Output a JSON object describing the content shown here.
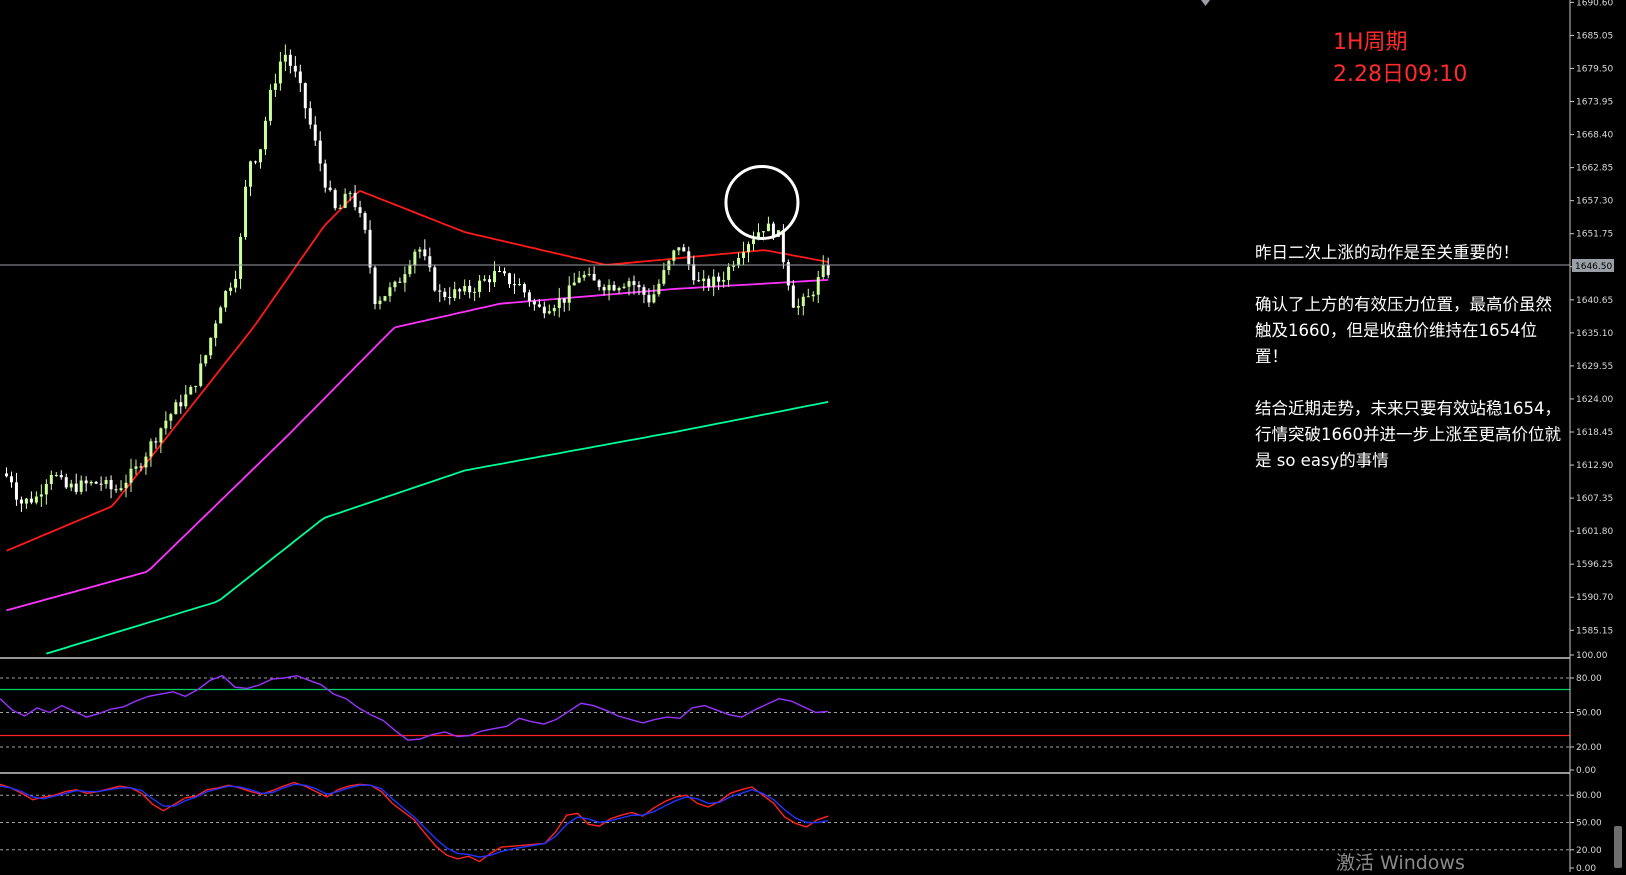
{
  "header": {
    "timeframe": "1H周期",
    "datetime": "2.28日09:10"
  },
  "notes": [
    "昨日二次上涨的动作是至关重要的！",
    "确认了上方的有效压力位置，最高价虽然触及1660，但是收盘价维持在1654位置！",
    "结合近期走势，未来只要有效站稳1654，行情突破1660并进一步上涨至更高价位就是 so easy的事情"
  ],
  "watermark": "激活 Windows",
  "colors": {
    "background": "#000000",
    "bull_candle": "#ccff99",
    "bear_candle": "#ffffff",
    "ma_fast": "#ff1a1a",
    "ma_mid": "#ff33ff",
    "ma_slow": "#00ff99",
    "rsi_line": "#9933ff",
    "rsi_upper": "#00cc66",
    "rsi_lower": "#ff2222",
    "k_line": "#ff2222",
    "d_line": "#2233ff",
    "highlight_circle": "#ffffff",
    "axis_text": "#d8d8d8"
  },
  "current_price": "1646.50",
  "chart_data": [
    {
      "type": "candlestick",
      "price_axis_ticks": [
        "1690.60",
        "1685.05",
        "1679.50",
        "1673.95",
        "1668.40",
        "1662.85",
        "1657.30",
        "1651.75",
        "1646.20",
        "1640.65",
        "1635.10",
        "1629.55",
        "1624.00",
        "1618.45",
        "1612.90",
        "1607.35",
        "1601.80",
        "1596.25",
        "1590.70",
        "1585.15"
      ],
      "ylim": [
        1581,
        1691
      ],
      "bars": 166,
      "ohlc_keypoints": [
        [
          0,
          1611.5
        ],
        [
          3,
          1610.5
        ],
        [
          5,
          1606.5
        ],
        [
          10,
          1607.5
        ],
        [
          14,
          1612
        ],
        [
          18,
          1609
        ],
        [
          28,
          1610
        ],
        [
          32,
          1608.5
        ],
        [
          38,
          1612
        ],
        [
          42,
          1616
        ],
        [
          46,
          1620
        ],
        [
          50,
          1623
        ],
        [
          54,
          1625.5
        ],
        [
          58,
          1631.5
        ],
        [
          62,
          1640
        ],
        [
          67,
          1646
        ],
        [
          70,
          1664
        ],
        [
          73,
          1665
        ],
        [
          76,
          1674.5
        ],
        [
          80,
          1682.5
        ],
        [
          84,
          1677.5
        ],
        [
          88,
          1669
        ],
        [
          92,
          1660
        ],
        [
          95,
          1655
        ],
        [
          99,
          1659
        ],
        [
          103,
          1652
        ],
        [
          106,
          1640.5
        ],
        [
          112,
          1643
        ],
        [
          118,
          1650
        ],
        [
          124,
          1641.5
        ],
        [
          132,
          1642
        ],
        [
          140,
          1645
        ],
        [
          147,
          1643
        ],
        [
          152,
          1639
        ],
        [
          156,
          1640
        ],
        [
          160,
          1641
        ],
        [
          164,
          1645
        ],
        [
          168,
          1643.5
        ],
        [
          173,
          1643
        ],
        [
          178,
          1644
        ],
        [
          184,
          1640.5
        ],
        [
          192,
          1650
        ],
        [
          198,
          1643
        ],
        [
          204,
          1644
        ],
        [
          210,
          1649.5
        ],
        [
          216,
          1653
        ],
        [
          220,
          1652
        ],
        [
          225,
          1639
        ],
        [
          229,
          1641
        ],
        [
          233,
          1645.5
        ]
      ],
      "moving_averages": [
        {
          "name": "MA-fast",
          "values_at": [
            [
              0,
              1598.5
            ],
            [
              30,
              1606
            ],
            [
              70,
              1636
            ],
            [
              90,
              1653
            ],
            [
              100,
              1659
            ],
            [
              130,
              1652
            ],
            [
              170,
              1646.5
            ],
            [
              215,
              1649
            ],
            [
              233,
              1647
            ]
          ]
        },
        {
          "name": "MA-mid",
          "values_at": [
            [
              0,
              1588.5
            ],
            [
              40,
              1595
            ],
            [
              80,
              1618
            ],
            [
              110,
              1636
            ],
            [
              140,
              1640
            ],
            [
              190,
              1642.5
            ],
            [
              233,
              1644
            ]
          ]
        },
        {
          "name": "MA-slow",
          "values_at": [
            [
              10,
              1581
            ],
            [
              60,
              1590
            ],
            [
              90,
              1604
            ],
            [
              130,
              1612
            ],
            [
              190,
              1618.5
            ],
            [
              233,
              1623.5
            ]
          ]
        }
      ],
      "annotation": "circle-at-high-1660"
    },
    {
      "type": "line",
      "panel": "oscillator-1",
      "ticks": [
        "100.00",
        "80.00",
        "50.00",
        "20.00",
        "0.00"
      ],
      "ylim": [
        0,
        100
      ],
      "levels": [
        70,
        30
      ],
      "series": [
        {
          "values": [
            62,
            52,
            47,
            54,
            50,
            56,
            51,
            46,
            49,
            53,
            55,
            60,
            64,
            66,
            68,
            64,
            70,
            78,
            82,
            72,
            71,
            74,
            79,
            80,
            82,
            78,
            74,
            66,
            62,
            54,
            48,
            43,
            34,
            26,
            27,
            31,
            33,
            29,
            30,
            34,
            36,
            38,
            45,
            42,
            40,
            44,
            51,
            58,
            56,
            52,
            47,
            44,
            41,
            44,
            46,
            45,
            54,
            56,
            52,
            48,
            46,
            52,
            57,
            62,
            60,
            55,
            50,
            51
          ]
        }
      ]
    },
    {
      "type": "line",
      "panel": "oscillator-2",
      "ticks": [
        "80.00",
        "50.00",
        "20.00",
        "0.00"
      ],
      "ylim": [
        0,
        100
      ],
      "series": [
        {
          "values": [
            92,
            88,
            82,
            75,
            78,
            80,
            84,
            86,
            82,
            84,
            87,
            90,
            88,
            82,
            70,
            63,
            70,
            77,
            79,
            86,
            88,
            91,
            88,
            84,
            81,
            85,
            90,
            94,
            90,
            84,
            78,
            86,
            90,
            92,
            91,
            84,
            71,
            62,
            53,
            38,
            24,
            14,
            10,
            13,
            7,
            16,
            23,
            24,
            25,
            26,
            27,
            40,
            58,
            60,
            48,
            46,
            54,
            58,
            61,
            57,
            66,
            73,
            78,
            80,
            71,
            67,
            73,
            82,
            86,
            89,
            80,
            71,
            56,
            49,
            45,
            53,
            57
          ]
        },
        {
          "values": [
            90,
            88,
            84,
            78,
            76,
            79,
            82,
            85,
            84,
            84,
            86,
            88,
            88,
            85,
            76,
            68,
            68,
            74,
            78,
            84,
            87,
            90,
            89,
            86,
            82,
            83,
            88,
            92,
            91,
            87,
            81,
            84,
            88,
            91,
            91,
            87,
            76,
            66,
            56,
            44,
            32,
            22,
            16,
            15,
            12,
            14,
            18,
            21,
            23,
            25,
            27,
            35,
            48,
            56,
            54,
            50,
            52,
            55,
            58,
            58,
            62,
            68,
            74,
            78,
            76,
            71,
            72,
            78,
            82,
            86,
            82,
            75,
            64,
            55,
            50,
            50,
            52
          ]
        }
      ]
    }
  ]
}
